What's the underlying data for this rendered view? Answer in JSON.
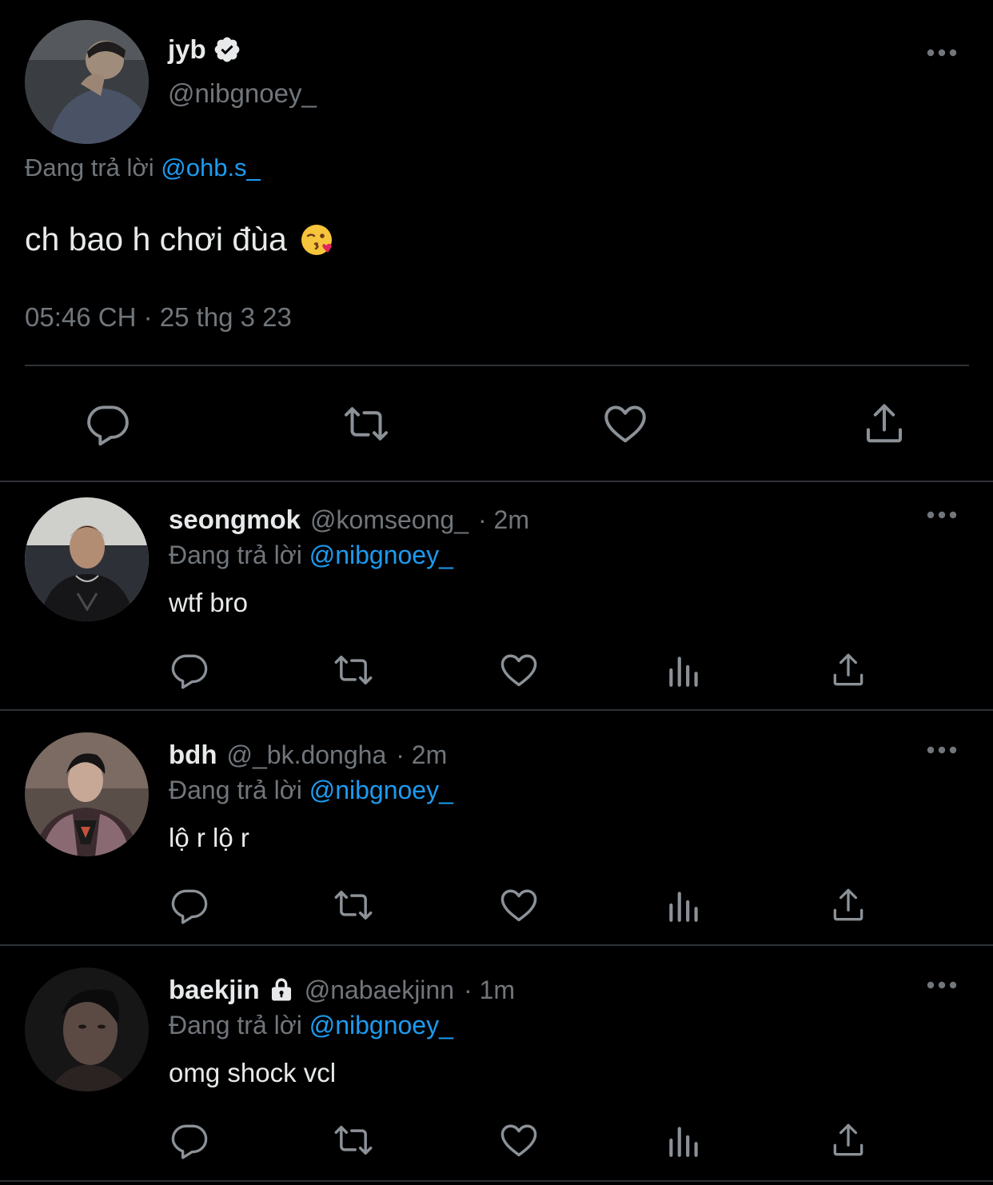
{
  "colors": {
    "background": "#000000",
    "text": "#e7e9ea",
    "muted": "#71767b",
    "accent": "#1d9bf0",
    "divider": "#2f3336"
  },
  "main_tweet": {
    "name": "jyb",
    "verified_icon": "verified-badge-icon",
    "handle": "@nibgnoey_",
    "replying_prefix": "Đang trả lời",
    "replying_to": "@ohb.s_",
    "text": "ch bao h chơi đùa",
    "emoji": "face-blowing-a-kiss",
    "timestamp": "05:46 CH · 25 thg 3 23",
    "actions": [
      "reply-icon",
      "retweet-icon",
      "like-icon",
      "share-icon"
    ]
  },
  "replies": [
    {
      "name": "seongmok",
      "handle": "@komseong_",
      "time": "· 2m",
      "replying_prefix": "Đang trả lời",
      "replying_to": "@nibgnoey_",
      "text": "wtf bro",
      "protected": false
    },
    {
      "name": "bdh",
      "handle": "@_bk.dongha",
      "time": "· 2m",
      "replying_prefix": "Đang trả lời",
      "replying_to": "@nibgnoey_",
      "text": "lộ r lộ r",
      "protected": false
    },
    {
      "name": "baekjin",
      "handle": "@nabaekjinn",
      "time": "· 1m",
      "replying_prefix": "Đang trả lời",
      "replying_to": "@nibgnoey_",
      "text": "omg shock vcl",
      "protected": true
    }
  ],
  "reply_actions": [
    "reply-icon",
    "retweet-icon",
    "like-icon",
    "views-icon",
    "share-icon"
  ]
}
